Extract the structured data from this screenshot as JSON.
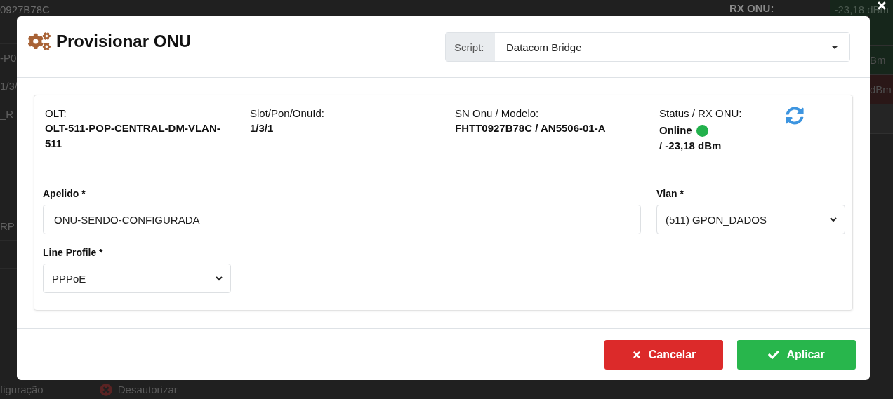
{
  "background": {
    "top": [
      "0927B78C",
      "RX ONU:",
      "-23,18 dBm"
    ],
    "left": [
      {
        "kind": "blank"
      },
      {
        "kind": "text",
        "text": "-P0"
      },
      {
        "kind": "text",
        "text": "1/3/"
      },
      {
        "kind": "text",
        "text": "_R"
      },
      {
        "kind": "blank"
      },
      {
        "kind": "blank"
      },
      {
        "kind": "blank"
      },
      {
        "kind": "text",
        "text": "RP"
      },
      {
        "kind": "blank"
      }
    ],
    "right": [
      {
        "color": "#16261b"
      },
      {
        "text": "Bm",
        "color": "#16261b"
      },
      {
        "text": "dBm",
        "color": "#2a1717"
      },
      {
        "color": "#252525"
      }
    ],
    "bottom": [
      "figuração",
      "Desautorizar"
    ]
  },
  "modal": {
    "title": "Provisionar ONU",
    "script": {
      "label": "Script:",
      "value": "Datacom Bridge"
    },
    "info": [
      {
        "kind": "text",
        "label": "OLT:",
        "value": "OLT-511-POP-CENTRAL-DM-VLAN-511"
      },
      {
        "kind": "text",
        "label": "Slot/Pon/OnuId:",
        "value": "1/3/1"
      },
      {
        "kind": "text",
        "label": "SN Onu / Modelo:",
        "value": "FHTT0927B78C / AN5506-01-A"
      },
      {
        "kind": "status",
        "label": "Status / RX ONU:",
        "value": "Online",
        "online": true,
        "reading": "/ -23,18 dBm"
      }
    ],
    "fields": [
      {
        "kind": "text",
        "label": "Apelido *",
        "value": "ONU-SENDO-CONFIGURADA"
      },
      {
        "kind": "select",
        "label": "Vlan *",
        "value": "(511) GPON_DADOS"
      },
      {
        "kind": "select",
        "label": "Line Profile *",
        "value": "PPPoE"
      }
    ],
    "buttons": [
      {
        "kind": "cancel",
        "label": "Cancelar"
      },
      {
        "kind": "apply",
        "label": "Aplicar"
      }
    ]
  }
}
